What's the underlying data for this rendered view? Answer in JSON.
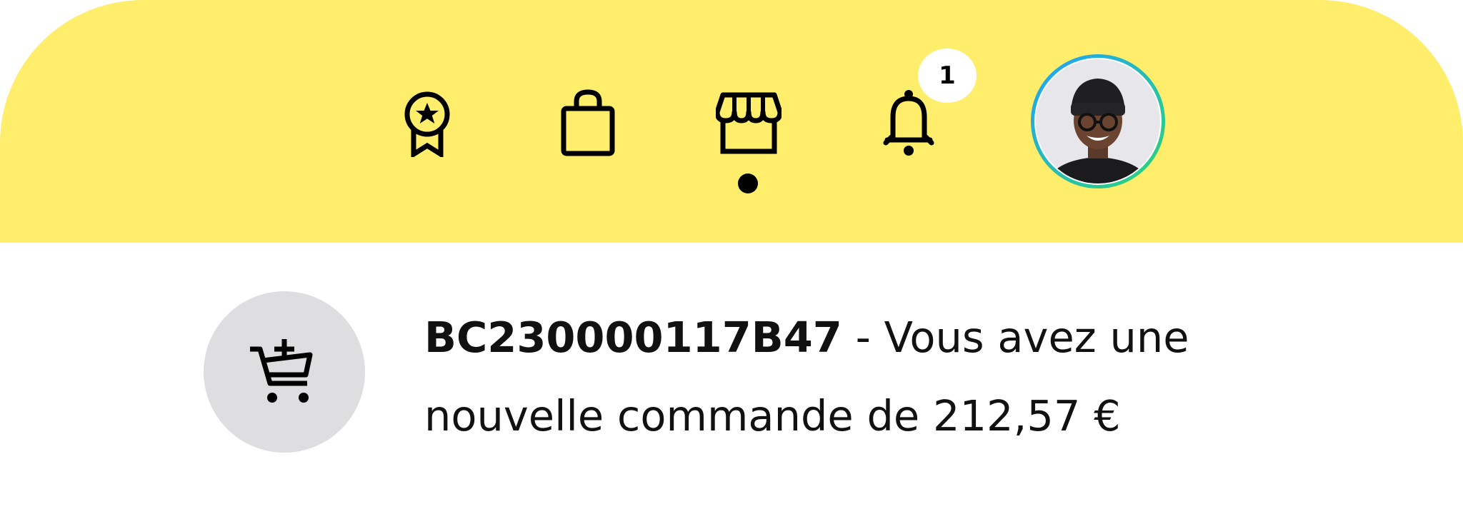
{
  "colors": {
    "header_bg": "#ffed6c",
    "icon": "#000000",
    "badge_bg": "#ffffff",
    "avatar_ring_start": "#1fa2ff",
    "avatar_ring_end": "#2ed573",
    "cart_circle_bg": "#dedee0",
    "text": "#111111"
  },
  "header": {
    "icons": [
      {
        "name": "award-icon",
        "active": false
      },
      {
        "name": "shopping-bag-icon",
        "active": false
      },
      {
        "name": "store-icon",
        "active": true
      },
      {
        "name": "bell-icon",
        "active": false,
        "badge": "1"
      }
    ],
    "notification_count": "1",
    "avatar": {
      "name": "avatar"
    }
  },
  "notification": {
    "icon": "cart-plus-icon",
    "reference": "BC230000117B47",
    "message": " - Vous avez une nouvelle commande de 212,57 €"
  }
}
